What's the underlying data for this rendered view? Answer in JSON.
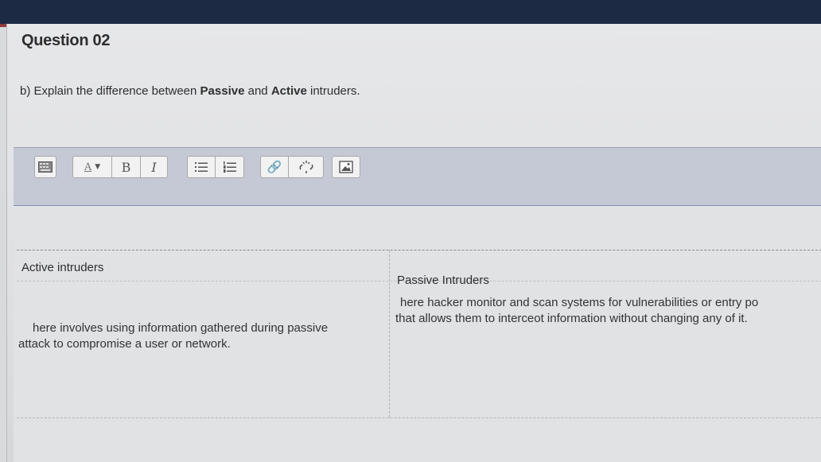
{
  "question": {
    "title": "Question 02",
    "prompt_prefix": "b) Explain the difference between ",
    "prompt_bold1": "Passive",
    "prompt_mid": " and ",
    "prompt_bold2": "Active",
    "prompt_suffix": " intruders."
  },
  "toolbar": {
    "font_color_label": "A",
    "bold_label": "B",
    "italic_label": "I"
  },
  "table": {
    "headers": [
      "Active intruders",
      "Passive Intruders"
    ],
    "cells": [
      [
        "here involves using information gathered during passive",
        "attack to compromise a user or network."
      ],
      [
        "here hacker monitor and scan systems for vulnerabilities or entry po",
        "that allows them to interceot information without changing any of it."
      ]
    ]
  }
}
